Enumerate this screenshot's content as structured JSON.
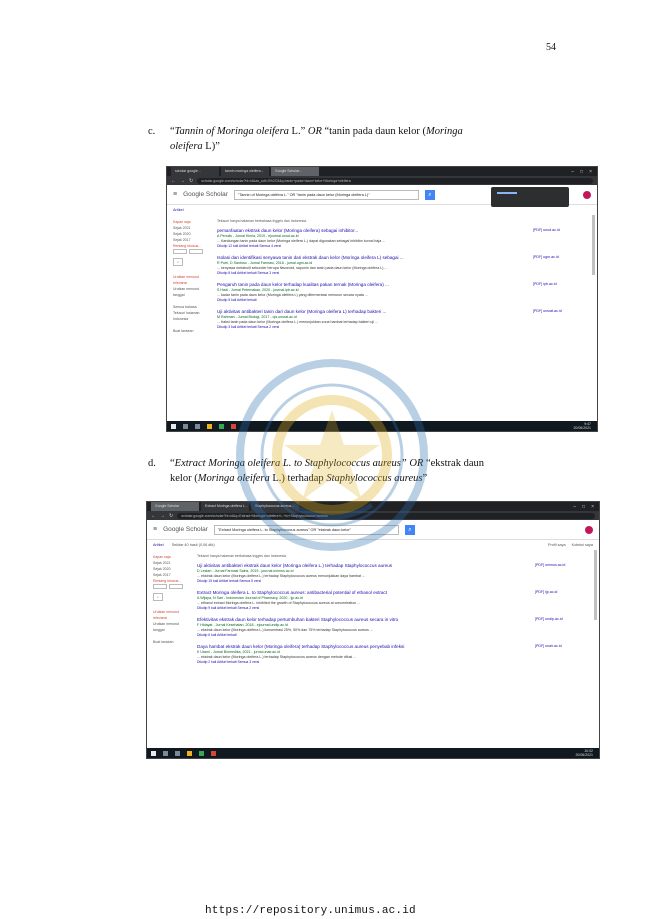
{
  "page": {
    "number": "54",
    "footer_url": "https://repository.unimus.ac.id"
  },
  "item_c": {
    "marker": "c.",
    "part1": "“",
    "part2": "Tannin of Moringa oleifera",
    "part3": " L.” ",
    "part4": "OR",
    "part5": " “tanin pada daun kelor (",
    "part6": "Moringa",
    "line2_part1": "oleifera",
    "line2_part2": " L)”"
  },
  "item_d": {
    "marker": "d.",
    "part1": "“",
    "part2": "Extract Moringa oleifera L. to Staphylococcus aureus”",
    "part3": " ",
    "part4": "OR",
    "part5": " “ekstrak daun",
    "line2_part1": "kelor (",
    "line2_part2": "Moringa oleifera",
    "line2_part3": " L.) terhadap ",
    "line2_part4": "Staphylococcus aureus",
    "line2_part5": "”"
  },
  "shot1": {
    "tabs": [
      "scholar google...",
      "tannin moringa oleifera...",
      "Google Scholar..."
    ],
    "url": "scholar.google.com/scholar?hl=id&as_sdt=0%2C5&q=tanin+pada+daun+kelor+Moringa+oleifera",
    "logo": "Google Scholar",
    "query": "\"Tannin of Moringa oleifera L.\" OR \"tanin pada daun kelor (Moringa oleifera L)\"",
    "sub_left": "Artikel",
    "note": "Telusuri hanya halaman berbahasa Inggris dan Indonesia.",
    "sidebar": [
      "Kapan saja",
      "Sejak 2021",
      "Sejak 2020",
      "Sejak 2017",
      "Rentang khusus...",
      "",
      "Urutkan menurut relevansi",
      "Urutkan menurut tanggal",
      "",
      "Semua bahasa",
      "Telusuri halaman Indonesia",
      "",
      "Buat lansiran"
    ],
    "results": [
      {
        "title": "pemanfaatan ekstrak daun kelor (Moringa oleifera) sebagai inhibitor...",
        "authors": "A Penulis - Jurnal Kimia, 2019 - ejournal.unud.ac.id",
        "snip": "... Kandungan tanin pada daun kelor (Moringa oleifera L.) dapat digunakan sebagai inhibitor korosi baja ...",
        "links": "Dikutip 12 kali  Artikel terkait  Semua 4 versi",
        "pdf": "[PDF] unud.ac.id"
      },
      {
        "title": "Isolasi dan identifikasi senyawa tanin dari ekstrak daun kelor (Moringa oleifera L) sebagai ...",
        "authors": "R Putri, D Santoso - Jurnal Farmasi, 2018 - jurnal.ugm.ac.id",
        "snip": "... senyawa metabolit sekunder berupa flavonoid, saponin dan tanin pada daun kelor (Moringa oleifera L) ...",
        "links": "Dikutip 8 kali  Artikel terkait  Semua 3 versi",
        "pdf": "[PDF] ugm.ac.id"
      },
      {
        "title": "Pengaruh tanin pada daun kelor terhadap kualitas pakan ternak (Moringa oleifera) ...",
        "authors": "S Hadi - Jurnal Peternakan, 2020 - journal.ipb.ac.id",
        "snip": "... kadar tanin pada daun kelor (Moringa oleifera L) yang difermentasi menurun secara nyata ...",
        "links": "Dikutip 5 kali  Artikel terkait",
        "pdf": "[PDF] ipb.ac.id"
      },
      {
        "title": "Uji aktivitas antibakteri tanin dari daun kelor (Moringa oleifera L) terhadap bakteri ...",
        "authors": "M Rahman - Jurnal Biologi, 2017 - ojs.unsrat.ac.id",
        "snip": "... fraksi tanin pada daun kelor (Moringa oleifera L.) menunjukkan zona hambat terhadap bakteri uji ...",
        "links": "Dikutip 3 kali  Artikel terkait  Semua 2 versi",
        "pdf": "[PDF] unsrat.ac.id"
      }
    ],
    "clock": "9:47\n20/06/2021"
  },
  "shot2": {
    "tabs": [
      "Google Scholar",
      "Extract Moringa oleifera L...",
      "Staphylococcus aureus..."
    ],
    "url": "scholar.google.com/scholar?hl=id&q=Extract+Moringa+oleifera+L.+to+Staphylococcus+aureus",
    "logo": "Google Scholar",
    "query": "\"Extract Moringa oleifera L. to Staphylococcus aureus\" OR \"ekstrak daun kelor\"",
    "sub_left": "Artikel",
    "sub_mid": "Sekitar 40 hasil (0,06 dtk)",
    "sub_right_1": "Profil saya",
    "sub_right_2": "Koleksi saya",
    "note": "Telusuri hanya halaman berbahasa Inggris dan Indonesia.",
    "sidebar": [
      "Kapan saja",
      "Sejak 2021",
      "Sejak 2020",
      "Sejak 2017",
      "Rentang khusus...",
      "",
      "Urutkan menurut relevansi",
      "Urutkan menurut tanggal",
      "",
      "Buat lansiran"
    ],
    "results": [
      {
        "title": "Uji aktivitas antibakteri ekstrak daun kelor (Moringa oleifera L.) terhadap Staphylococcus aureus",
        "authors": "D Lestari - Jurnal Farmasi Sains, 2019 - journal.unimus.ac.id",
        "snip": "... ekstrak daun kelor (Moringa oleifera L.) terhadap Staphylococcus aureus menunjukkan daya hambat ...",
        "links": "Dikutip 15 kali  Artikel terkait  Semua 5 versi",
        "pdf": "[PDF] unimus.ac.id"
      },
      {
        "title": "Extract Moringa oleifera L. to Staphylococcus aureus: antibacterial potential of ethanol extract",
        "authors": "A Wijaya, N Sari - Indonesian Journal of Pharmacy, 2020 - ijp.ac.id",
        "snip": "... ethanol extract Moringa oleifera L. inhibited the growth of Staphylococcus aureus at concentration ...",
        "links": "Dikutip 9 kali  Artikel terkait  Semua 2 versi",
        "pdf": "[PDF] ijp.ac.id"
      },
      {
        "title": "Efektivitas ekstrak daun kelor terhadap pertumbuhan bakteri Staphylococcus aureus secara in vitro",
        "authors": "F Hidayat - Jurnal Kesehatan, 2018 - ejournal.undip.ac.id",
        "snip": "... ekstrak daun kelor (Moringa oleifera L.) konsentrasi 25%, 50% dan 75% terhadap Staphylococcus aureus ...",
        "links": "Dikutip 6 kali  Artikel terkait",
        "pdf": "[PDF] undip.ac.id"
      },
      {
        "title": "Daya hambat ekstrak daun kelor (Moringa oleifera) terhadap Staphylococcus aureus penyebab infeksi",
        "authors": "K Utami - Jurnal Biomedika, 2021 - jurnal.unair.ac.id",
        "snip": "... ekstrak daun kelor (Moringa oleifera L.) terhadap Staphylococcus aureus dengan metode difusi ...",
        "links": "Dikutip 2 kali  Artikel terkait  Semua 3 versi",
        "pdf": "[PDF] unair.ac.id"
      }
    ],
    "clock": "10:02\n20/06/2021"
  },
  "colors": {
    "link": "#1a0dab",
    "green": "#006621",
    "chrome_dark": "#202124",
    "taskbar": "#101820",
    "scholar_blue": "#4285f4"
  }
}
